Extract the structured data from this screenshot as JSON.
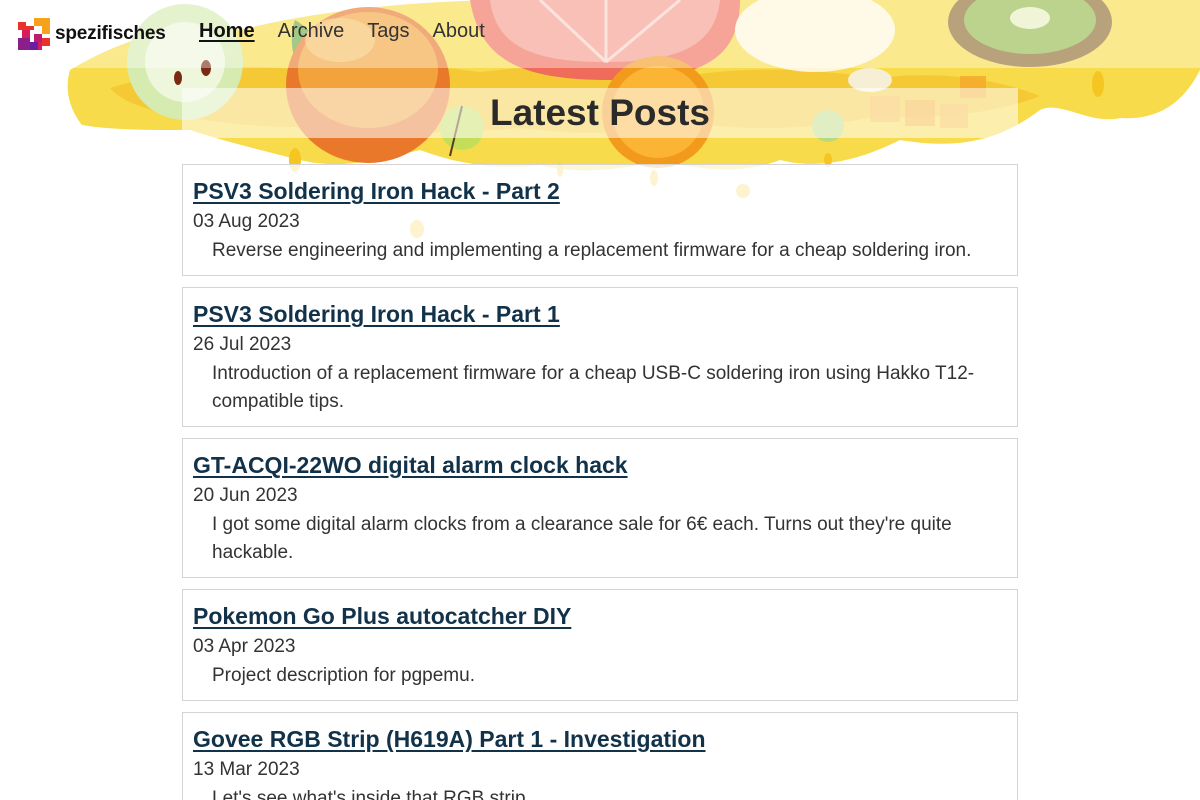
{
  "brand": {
    "name": "spezifisches",
    "logo_icon": "pixel-logo-icon"
  },
  "nav": {
    "items": [
      {
        "label": "Home",
        "active": true
      },
      {
        "label": "Archive",
        "active": false
      },
      {
        "label": "Tags",
        "active": false
      },
      {
        "label": "About",
        "active": false
      }
    ]
  },
  "main": {
    "title": "Latest Posts",
    "posts": [
      {
        "title": "PSV3 Soldering Iron Hack - Part 2",
        "date": "03 Aug 2023",
        "summary": "Reverse engineering and implementing a replacement firmware for a cheap soldering iron."
      },
      {
        "title": "PSV3 Soldering Iron Hack - Part 1",
        "date": "26 Jul 2023",
        "summary": "Introduction of a replacement firmware for a cheap USB-C soldering iron using Hakko T12-compatible tips."
      },
      {
        "title": "GT-ACQI-22WO digital alarm clock hack",
        "date": "20 Jun 2023",
        "summary": "I got some digital alarm clocks from a clearance sale for 6€ each. Turns out they're quite hackable."
      },
      {
        "title": "Pokemon Go Plus autocatcher DIY",
        "date": "03 Apr 2023",
        "summary": "Project description for pgpemu."
      },
      {
        "title": "Govee RGB Strip (H619A) Part 1 - Investigation",
        "date": "13 Mar 2023",
        "summary": "Let's see what's inside that RGB strip."
      }
    ]
  },
  "colors": {
    "link": "#12324a",
    "border": "#d4d4d4",
    "splash_yellow": "#f7d63a",
    "splash_orange": "#f4a21c"
  }
}
